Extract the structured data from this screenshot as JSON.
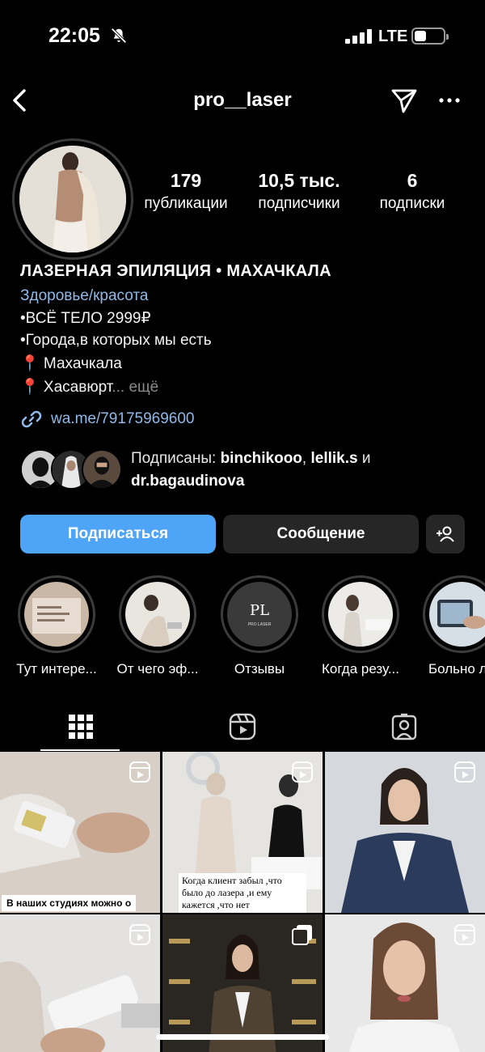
{
  "status_bar": {
    "time": "22:05",
    "network": "LTE",
    "icons": [
      "bell-slash-icon",
      "signal-icon",
      "battery-icon"
    ]
  },
  "nav": {
    "title": "pro__laser",
    "icons": [
      "back-icon",
      "send-icon",
      "more-icon"
    ]
  },
  "profile": {
    "stats": [
      {
        "value": "179",
        "label": "публикации"
      },
      {
        "value": "10,5 тыс.",
        "label": "подписчики"
      },
      {
        "value": "6",
        "label": "подписки"
      }
    ],
    "name": "ЛАЗЕРНАЯ ЭПИЛЯЦИЯ • МАХАЧКАЛА",
    "category": "Здоровье/красота",
    "bio_lines": [
      "•ВСЁ ТЕЛО 2999₽",
      "•Города,в которых мы есть",
      "📍 Махачкала",
      "📍 Хасавюрт"
    ],
    "more_label": "... ещё",
    "link": "wa.me/79175969600",
    "followed_by": {
      "prefix": "Подписаны: ",
      "user1": "binchikooo",
      "sep": ", ",
      "user2": "lellik.s",
      "and": " и",
      "user3": "dr.bagaudinova"
    }
  },
  "actions": {
    "follow": "Подписаться",
    "message": "Сообщение"
  },
  "highlights": [
    {
      "label": "Тут интере..."
    },
    {
      "label": "От чего эф..."
    },
    {
      "label": "Отзывы",
      "logo": "PL",
      "logo_sub": "PRO LASER"
    },
    {
      "label": "Когда резу..."
    },
    {
      "label": "Больно ли"
    }
  ],
  "tabs": [
    "grid-icon",
    "reels-icon",
    "tagged-icon"
  ],
  "posts": [
    {
      "caption": "В наших студиях можно о",
      "type": "reel"
    },
    {
      "caption": "Когда клиент забыл ,что было до лазера ,и ему кажется ,что нет",
      "type": "reel"
    },
    {
      "caption": "",
      "type": "reel"
    },
    {
      "caption": "",
      "type": "reel"
    },
    {
      "caption": "",
      "type": "carousel"
    },
    {
      "caption": "",
      "type": "reel"
    }
  ],
  "colors": {
    "background": "#000000",
    "accent": "#4ea4f7",
    "link": "#8fb9e8",
    "secondary_button": "#262626"
  }
}
